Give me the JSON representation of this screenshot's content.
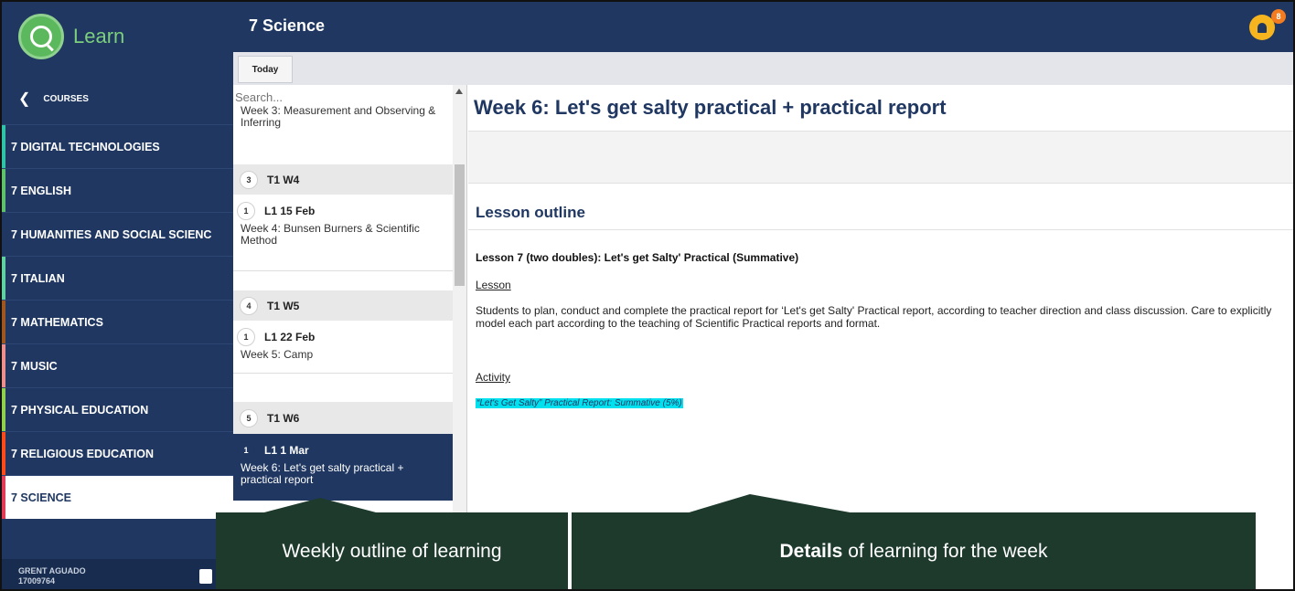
{
  "brand": {
    "name": "Learn"
  },
  "nav": {
    "back_label": "COURSES"
  },
  "courses": [
    {
      "label": "7 DIGITAL TECHNOLOGIES",
      "color": "#2fc4a8"
    },
    {
      "label": "7 ENGLISH",
      "color": "#5ec26a"
    },
    {
      "label": "7 HUMANITIES AND SOCIAL SCIENC",
      "color": "#1f3761"
    },
    {
      "label": "7 ITALIAN",
      "color": "#5fd1a3"
    },
    {
      "label": "7 MATHEMATICS",
      "color": "#a0561f"
    },
    {
      "label": "7 MUSIC",
      "color": "#ee8f8f"
    },
    {
      "label": "7 PHYSICAL EDUCATION",
      "color": "#8fd14c"
    },
    {
      "label": "7 RELIGIOUS EDUCATION",
      "color": "#ff4a1a"
    },
    {
      "label": "7 SCIENCE",
      "color": "#e33b57"
    }
  ],
  "user": {
    "name": "GRENT AGUADO",
    "id": "17009764"
  },
  "header": {
    "course_title": "7 Science",
    "notification_count": "8"
  },
  "toolbar": {
    "today_label": "Today"
  },
  "weeklist": {
    "search_placeholder": "Search...",
    "cut_text": "Week 3: Measurement and Observing & Inferring",
    "weeks": [
      {
        "num": "3",
        "label": "T1  W4",
        "lesson_num": "1",
        "lesson_label": "L1  15 Feb",
        "lesson_desc": "Week 4: Bunsen Burners & Scientific Method"
      },
      {
        "num": "4",
        "label": "T1  W5",
        "lesson_num": "1",
        "lesson_label": "L1  22 Feb",
        "lesson_desc": "Week 5: Camp"
      },
      {
        "num": "5",
        "label": "T1  W6",
        "lesson_num": "1",
        "lesson_label": "L1  1 Mar",
        "lesson_desc": "Week 6: Let's get salty practical + practical report"
      }
    ]
  },
  "details": {
    "title": "Week 6: Let's get salty practical + practical report",
    "outline_heading": "Lesson outline",
    "lesson_title": "Lesson 7 (two doubles): Let's get Salty' Practical (Summative)",
    "lesson_label": "Lesson",
    "lesson_body": "Students to plan, conduct and complete the practical report for ‘Let's get Salty' Practical report, according to teacher direction and class discussion. Care to explicitly model each part according to the teaching of Scientific Practical reports and format.",
    "activity_label": "Activity",
    "activity_item": "“Let's Get Salty” Practical Report: Summative (5%)"
  },
  "callouts": {
    "left": "Weekly outline of learning",
    "right_bold": "Details",
    "right_rest": " of learning for the week"
  },
  "icons": [
    "logo-icon",
    "chevron-left-icon",
    "bell-icon",
    "logout-icon"
  ]
}
